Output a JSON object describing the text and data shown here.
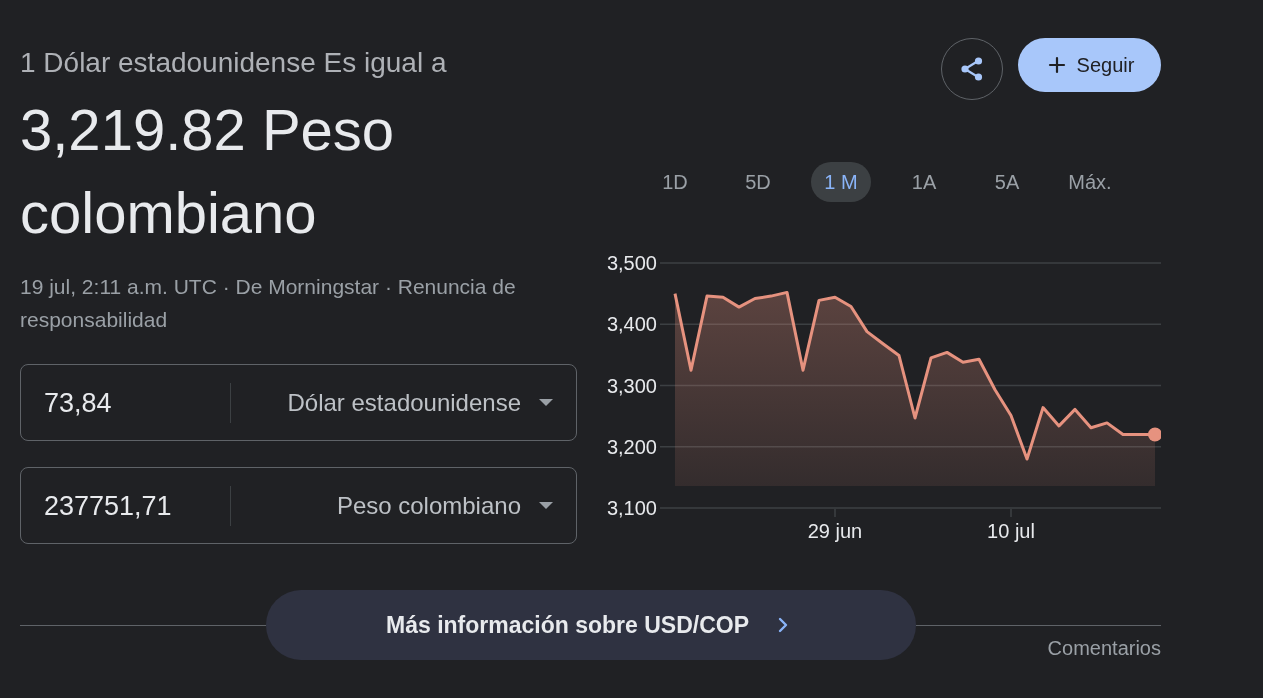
{
  "conversion": {
    "caption": "1 Dólar estadounidense Es igual a",
    "result": "3,219.82 Peso colombiano",
    "meta": "19 jul, 2:11 a.m. UTC · De Morningstar · Renuncia de responsabilidad"
  },
  "converter": [
    {
      "amount": "73,84",
      "currency": "Dólar estadounidense"
    },
    {
      "amount": "237751,71",
      "currency": "Peso colombiano"
    }
  ],
  "actions": {
    "follow_button": "Seguir"
  },
  "range_tabs": [
    {
      "label": "1D",
      "selected": false
    },
    {
      "label": "5D",
      "selected": false
    },
    {
      "label": "1 M",
      "selected": true
    },
    {
      "label": "1A",
      "selected": false
    },
    {
      "label": "5A",
      "selected": false
    },
    {
      "label": "Máx.",
      "selected": false
    }
  ],
  "chart": {
    "chart_data": {
      "type": "area",
      "grid": true,
      "categories": [
        null,
        null,
        null,
        null,
        null,
        null,
        null,
        null,
        null,
        null,
        "29 jun",
        null,
        null,
        null,
        null,
        null,
        null,
        null,
        null,
        null,
        null,
        "10 jul",
        null,
        null,
        null,
        null,
        null,
        null,
        null,
        null,
        null
      ],
      "values": [
        3450,
        3325,
        3446,
        3444,
        3428,
        3442,
        3446,
        3452,
        3325,
        3439,
        3444,
        3429,
        3388,
        3368,
        3349,
        3247,
        3345,
        3354,
        3338,
        3343,
        3293,
        3251,
        3180,
        3264,
        3234,
        3261,
        3231,
        3239,
        3220,
        3220,
        3220
      ],
      "ylim": [
        3100,
        3500
      ],
      "yticks": [
        {
          "value": 3100,
          "label": "3,100"
        },
        {
          "value": 3200,
          "label": "3,200"
        },
        {
          "value": 3300,
          "label": "3,300"
        },
        {
          "value": 3400,
          "label": "3,400"
        },
        {
          "value": 3500,
          "label": "3,500"
        }
      ]
    }
  },
  "footer": {
    "more_button": "Más información sobre USD/COP",
    "feedback_link": "Comentarios"
  }
}
